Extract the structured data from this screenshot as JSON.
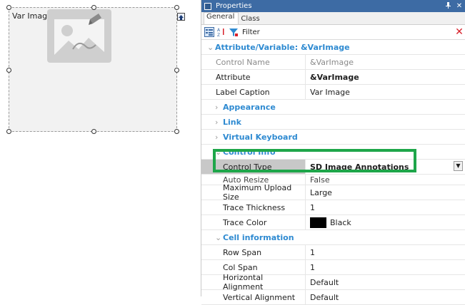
{
  "designer": {
    "control_label": "Var Image",
    "placeholder_icon": "image-placeholder-icon",
    "upload_icon": "upload-arrow-icon"
  },
  "panel": {
    "title": "Properties",
    "title_icon": "properties-window-icon",
    "pin_icon": "pin-icon",
    "close_label": "✕",
    "tabs": [
      "General",
      "Class"
    ],
    "toolbar": {
      "categorized_icon": "categorized-sort-icon",
      "alpha_icon": "alphabetical-sort-icon",
      "filter_icon": "funnel-icon",
      "filter_label": "Filter",
      "clear_label": "✕"
    }
  },
  "grid": {
    "section_attr": "Attribute/Variable: &VarImage",
    "control_name_label": "Control Name",
    "control_name_value": "&VarImage",
    "attribute_label": "Attribute",
    "attribute_value": "&VarImage",
    "label_caption_label": "Label Caption",
    "label_caption_value": "Var Image",
    "appearance": "Appearance",
    "link": "Link",
    "virtual_keyboard": "Virtual Keyboard",
    "control_info": "Control Info",
    "control_type_label": "Control Type",
    "control_type_value": "SD Image Annotations",
    "auto_resize_label": "Auto Resize",
    "auto_resize_value": "False",
    "max_upload_label": "Maximum Upload Size",
    "max_upload_value": "Large",
    "trace_thickness_label": "Trace Thickness",
    "trace_thickness_value": "1",
    "trace_color_label": "Trace Color",
    "trace_color_value": "Black",
    "trace_color_hex": "#000000",
    "cell_info": "Cell information",
    "row_span_label": "Row Span",
    "row_span_value": "1",
    "col_span_label": "Col Span",
    "col_span_value": "1",
    "h_align_label": "Horizontal Alignment",
    "h_align_value": "Default",
    "v_align_label": "Vertical Alignment",
    "v_align_value": "Default"
  },
  "colors": {
    "titlebar": "#3d6ba4",
    "category_text": "#2e8ad1",
    "highlight": "#1ea64a",
    "clear_filter": "#d7202a"
  }
}
